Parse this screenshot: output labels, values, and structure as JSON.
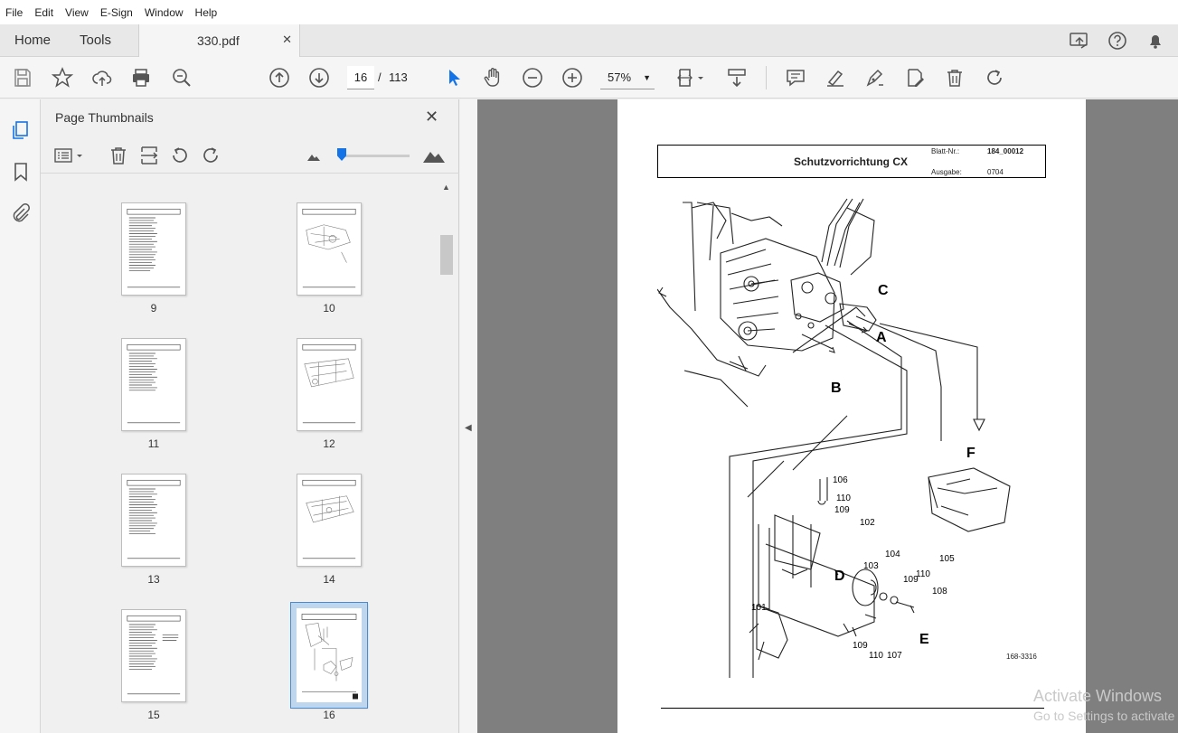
{
  "menu": [
    "File",
    "Edit",
    "View",
    "E-Sign",
    "Window",
    "Help"
  ],
  "tabs": {
    "home": "Home",
    "tools": "Tools",
    "doc_title": "330.pdf",
    "close": "✕"
  },
  "toolbar": {
    "page_current": "16",
    "page_sep": "/",
    "page_total": "113",
    "zoom": "57%"
  },
  "panel": {
    "title": "Page Thumbnails",
    "close": "✕"
  },
  "thumbnails": [
    {
      "label": "9"
    },
    {
      "label": "10"
    },
    {
      "label": "11"
    },
    {
      "label": "12"
    },
    {
      "label": "13"
    },
    {
      "label": "14"
    },
    {
      "label": "15"
    },
    {
      "label": "16"
    }
  ],
  "document": {
    "header_title": "Schutzvorrichtung CX",
    "blatt_key": "Blatt-Nr.:",
    "blatt_value": "184_00012",
    "ausgabe_key": "Ausgabe:",
    "ausgabe_value": "0704",
    "drawing_ref": "168-3316",
    "callouts": [
      "C",
      "A",
      "B",
      "F",
      "D",
      "E",
      "106",
      "110",
      "109",
      "102",
      "103",
      "104",
      "110",
      "109",
      "108",
      "101",
      "105",
      "109",
      "110",
      "107"
    ]
  },
  "watermark": {
    "line1": "Activate Windows",
    "line2": "Go to Settings to activate"
  },
  "colors": {
    "accent": "#1473e6",
    "doc_bg": "#7f7f7f"
  }
}
